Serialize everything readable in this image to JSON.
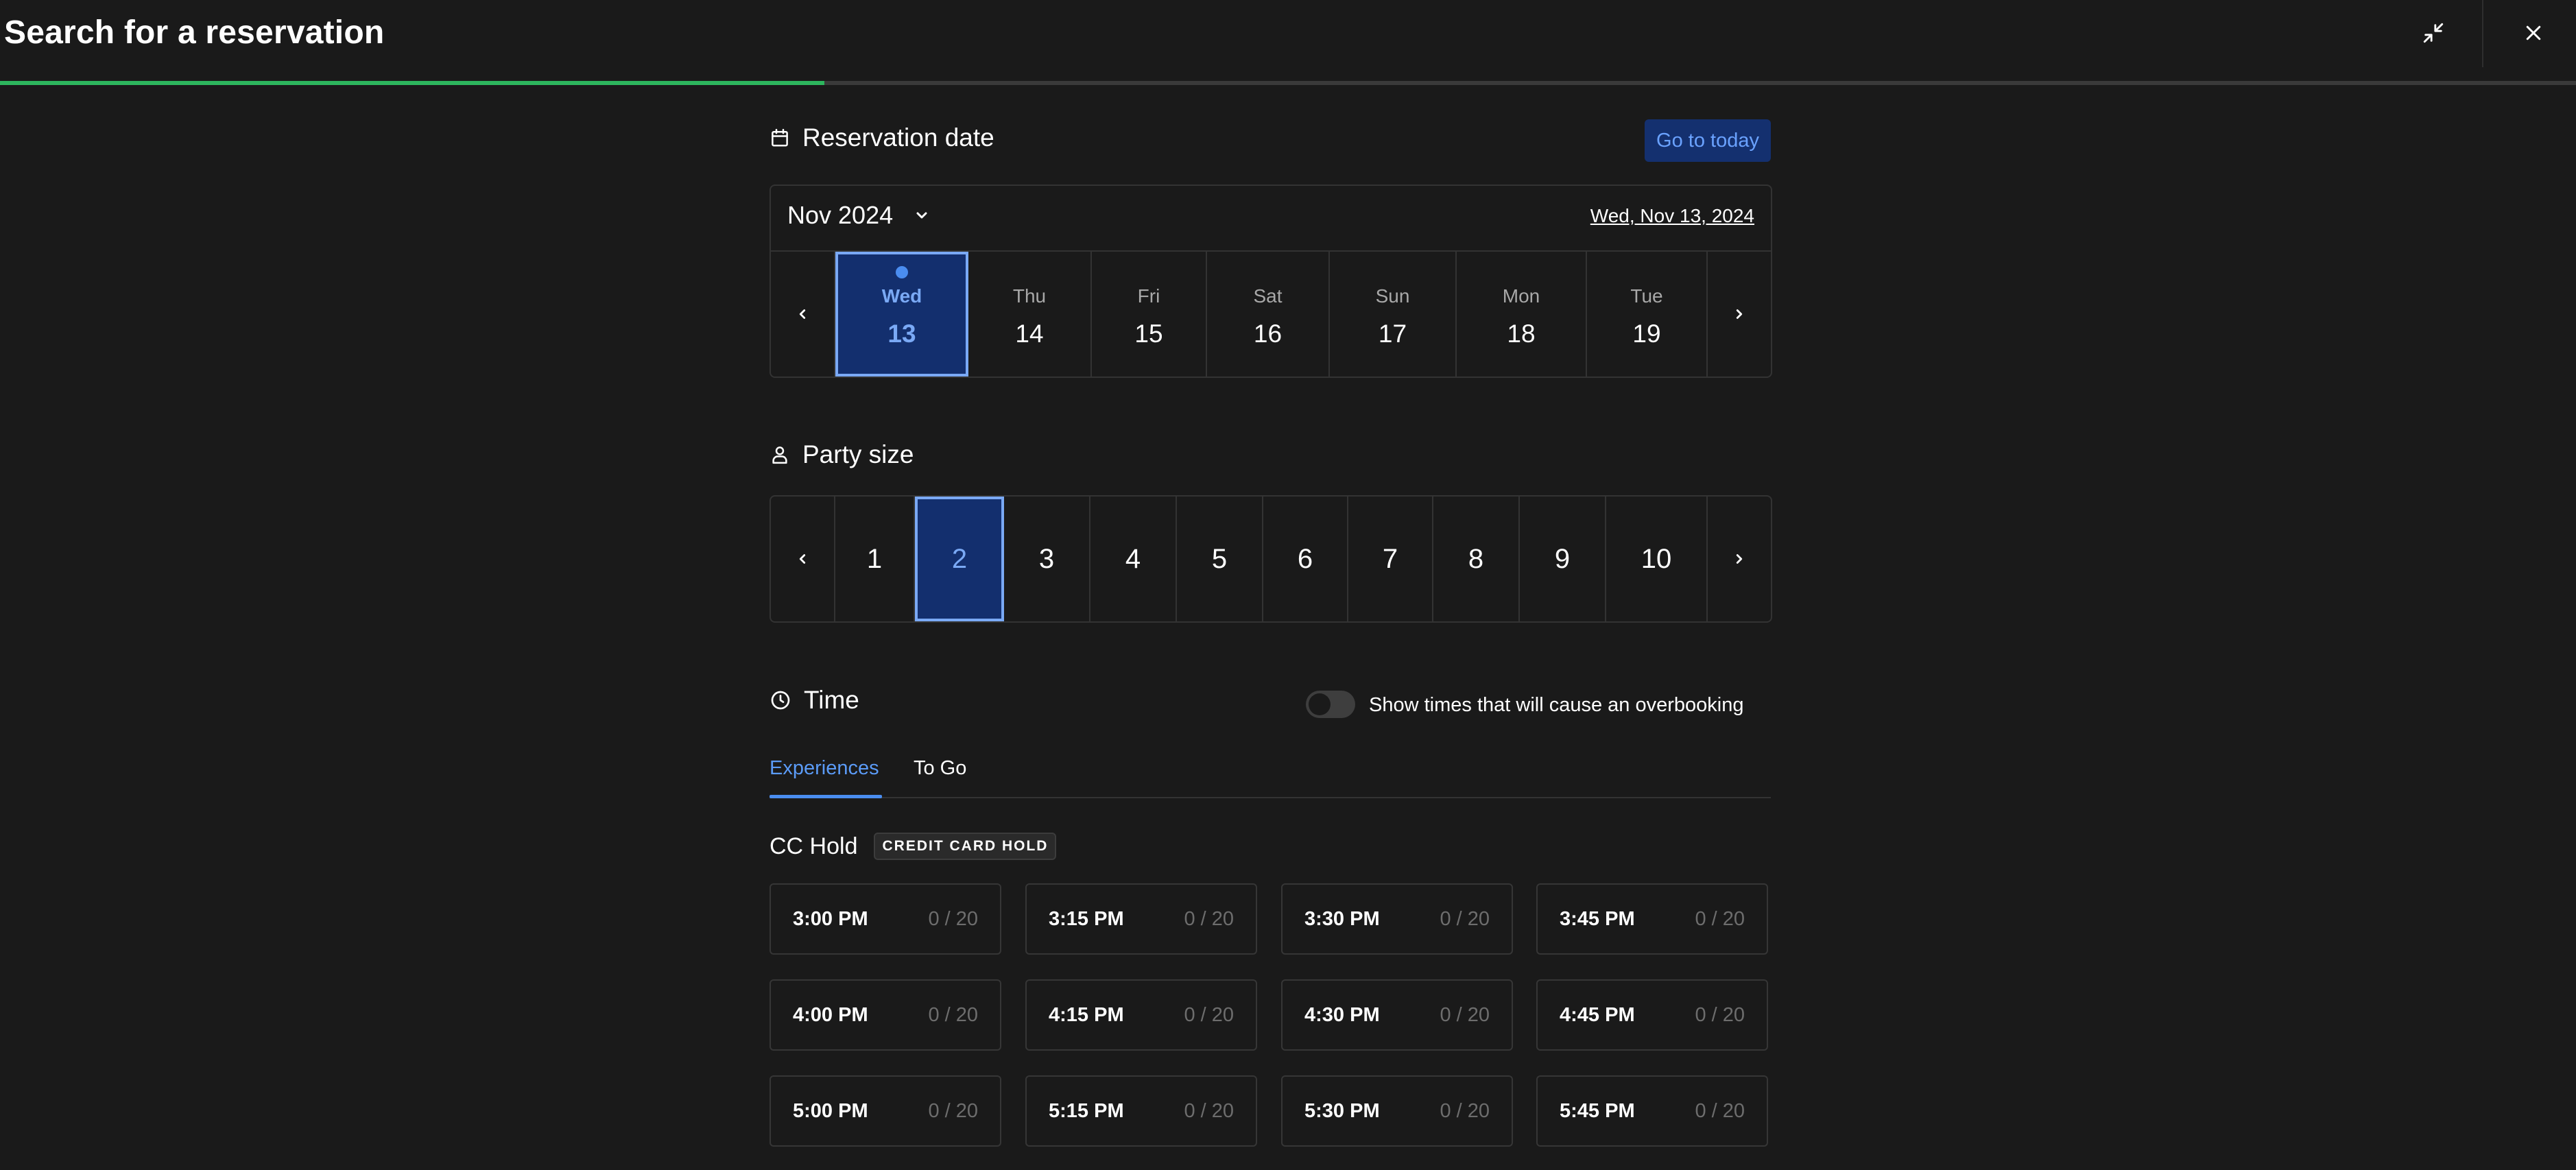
{
  "header": {
    "title": "Search for a reservation",
    "minimize_icon": "minimize-icon",
    "close_icon": "close-icon",
    "progress_fraction": 0.32,
    "progress_color": "#2db55d"
  },
  "reservation_date": {
    "title": "Reservation date",
    "icon": "calendar-icon",
    "go_to_today_label": "Go to today",
    "month_label": "Nov 2024",
    "selected_date_label": "Wed, Nov 13, 2024",
    "days": [
      {
        "name": "Wed",
        "num": "13",
        "selected": true,
        "today": true
      },
      {
        "name": "Thu",
        "num": "14"
      },
      {
        "name": "Fri",
        "num": "15"
      },
      {
        "name": "Sat",
        "num": "16"
      },
      {
        "name": "Sun",
        "num": "17"
      },
      {
        "name": "Mon",
        "num": "18"
      },
      {
        "name": "Tue",
        "num": "19"
      }
    ]
  },
  "party_size": {
    "title": "Party size",
    "icon": "person-icon",
    "options": [
      "1",
      "2",
      "3",
      "4",
      "5",
      "6",
      "7",
      "8",
      "9",
      "10"
    ],
    "selected": "2"
  },
  "time": {
    "title": "Time",
    "icon": "clock-icon",
    "overbooking_toggle_label": "Show times that will cause an overbooking",
    "overbooking_enabled": false,
    "tabs": [
      {
        "label": "Experiences",
        "active": true
      },
      {
        "label": "To Go",
        "active": false
      }
    ],
    "group": {
      "title": "CC Hold",
      "badge": "CREDIT CARD HOLD",
      "slots": [
        {
          "time": "3:00 PM",
          "capacity": "0 / 20"
        },
        {
          "time": "3:15 PM",
          "capacity": "0 / 20"
        },
        {
          "time": "3:30 PM",
          "capacity": "0 / 20"
        },
        {
          "time": "3:45 PM",
          "capacity": "0 / 20"
        },
        {
          "time": "4:00 PM",
          "capacity": "0 / 20"
        },
        {
          "time": "4:15 PM",
          "capacity": "0 / 20"
        },
        {
          "time": "4:30 PM",
          "capacity": "0 / 20"
        },
        {
          "time": "4:45 PM",
          "capacity": "0 / 20"
        },
        {
          "time": "5:00 PM",
          "capacity": "0 / 20"
        },
        {
          "time": "5:15 PM",
          "capacity": "0 / 20"
        },
        {
          "time": "5:30 PM",
          "capacity": "0 / 20"
        },
        {
          "time": "5:45 PM",
          "capacity": "0 / 20"
        }
      ]
    }
  },
  "colors": {
    "background": "#1a1a1a",
    "accent": "#4a8df0",
    "selected_bg": "#132f6e",
    "selected_border": "#7aa9f5"
  }
}
